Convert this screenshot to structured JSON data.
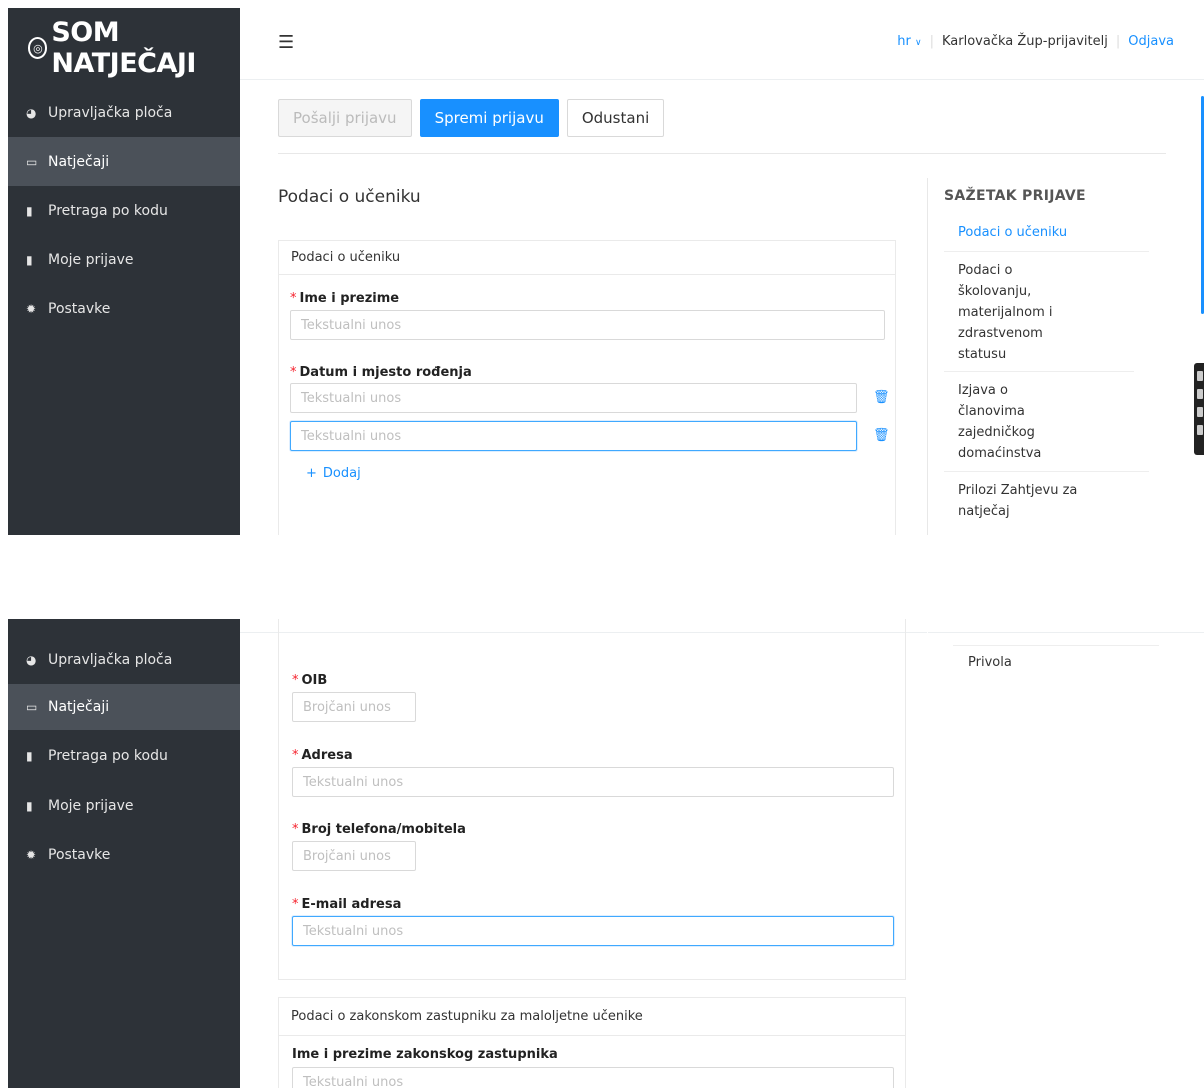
{
  "brand": {
    "logo_text": "SOM NATJEČAJI"
  },
  "sidebar": {
    "items": [
      {
        "label": "Upravljačka ploča",
        "icon": "pie-chart-icon"
      },
      {
        "label": "Natječaji",
        "icon": "folder-open-icon"
      },
      {
        "label": "Pretraga po kodu",
        "icon": "file-icon"
      },
      {
        "label": "Moje prijave",
        "icon": "file-text-icon"
      },
      {
        "label": "Postavke",
        "icon": "settings-icon"
      }
    ],
    "active_index": 1
  },
  "header": {
    "lang": "hr",
    "user": "Karlovačka Žup-prijavitelj",
    "logout": "Odjava"
  },
  "toolbar": {
    "send": "Pošalji prijavu",
    "save": "Spremi prijavu",
    "cancel": "Odustani"
  },
  "form": {
    "section_title": "Podaci o učeniku",
    "card1_title": "Podaci o učeniku",
    "name_label": "Ime i prezime",
    "text_placeholder": "Tekstualni unos",
    "numeric_placeholder": "Brojčani unos",
    "dob_label": "Datum i mjesto rođenja",
    "add": "Dodaj",
    "oib_label": "OIB",
    "address_label": "Adresa",
    "phone_label": "Broj telefona/mobitela",
    "email_label": "E-mail adresa",
    "card2_title": "Podaci o zakonskom zastupniku za maloljetne učenike",
    "guardian_label": "Ime i prezime zakonskog zastupnika",
    "required_mark": "*"
  },
  "summary": {
    "title": "SAŽETAK PRIJAVE",
    "items": [
      "Podaci o učeniku",
      "Podaci o školovanju, materijalnom i zdrastvenom statusu",
      "Izjava o članovima zajedničkog domaćinstva",
      "Prilozi Zahtjevu za natječaj",
      "Privola"
    ],
    "active_index": 0
  }
}
